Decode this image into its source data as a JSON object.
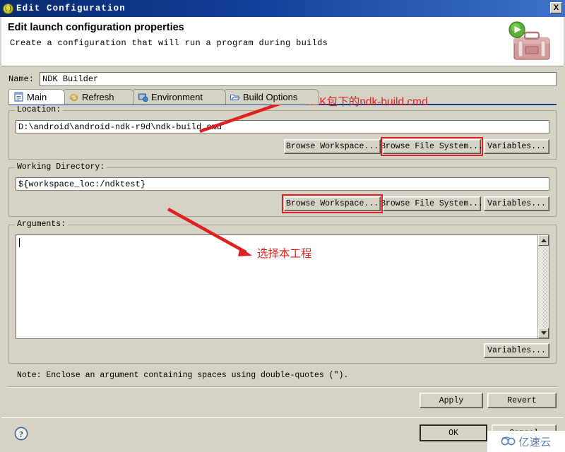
{
  "window": {
    "title": "Edit Configuration",
    "icon": "config-circle-icon",
    "close_label": "X"
  },
  "header": {
    "title": "Edit launch configuration properties",
    "subtitle": "Create a configuration that will run a program during builds",
    "art_icon": "toolbox-with-run-icon"
  },
  "name_field": {
    "label": "Name:",
    "value": "NDK Builder"
  },
  "tabs": [
    {
      "label": "Main",
      "icon": "document-icon",
      "selected": true
    },
    {
      "label": "Refresh",
      "icon": "refresh-arrows-icon",
      "selected": false
    },
    {
      "label": "Environment",
      "icon": "environment-icon",
      "selected": false
    },
    {
      "label": "Build Options",
      "icon": "folder-open-icon",
      "selected": false
    }
  ],
  "location": {
    "legend": "Location:",
    "value": "D:\\android\\android-ndk-r9d\\ndk-build.cmd",
    "buttons": [
      {
        "label": "Browse Workspace...",
        "highlighted": false
      },
      {
        "label": "Browse File System...",
        "highlighted": true
      },
      {
        "label": "Variables...",
        "highlighted": false
      }
    ]
  },
  "working_directory": {
    "legend": "Working Directory:",
    "value": "${workspace_loc:/ndktest}",
    "buttons": [
      {
        "label": "Browse Workspace...",
        "highlighted": true
      },
      {
        "label": "Browse File System...",
        "highlighted": false
      },
      {
        "label": "Variables...",
        "highlighted": false
      }
    ]
  },
  "arguments": {
    "legend": "Arguments:",
    "value": "",
    "variables_button": "Variables...",
    "note": "Note: Enclose an argument containing spaces using double-quotes (\")."
  },
  "form_buttons": {
    "apply": "Apply",
    "revert": "Revert"
  },
  "footer": {
    "help_icon": "question-mark-icon",
    "ok": "OK",
    "cancel": "Cancel"
  },
  "annotations": [
    {
      "text": "NDK包下的ndk-build.cmd",
      "name": "annotation-ndk-build-path"
    },
    {
      "text": "选择本工程",
      "name": "annotation-select-project"
    }
  ],
  "watermark": {
    "text": "亿速云",
    "icon": "cloud-logo-icon"
  },
  "colors": {
    "annotation_red": "#e02020",
    "titlebar_blue": "#12409c",
    "dialog_bg": "#d6d2c6"
  }
}
